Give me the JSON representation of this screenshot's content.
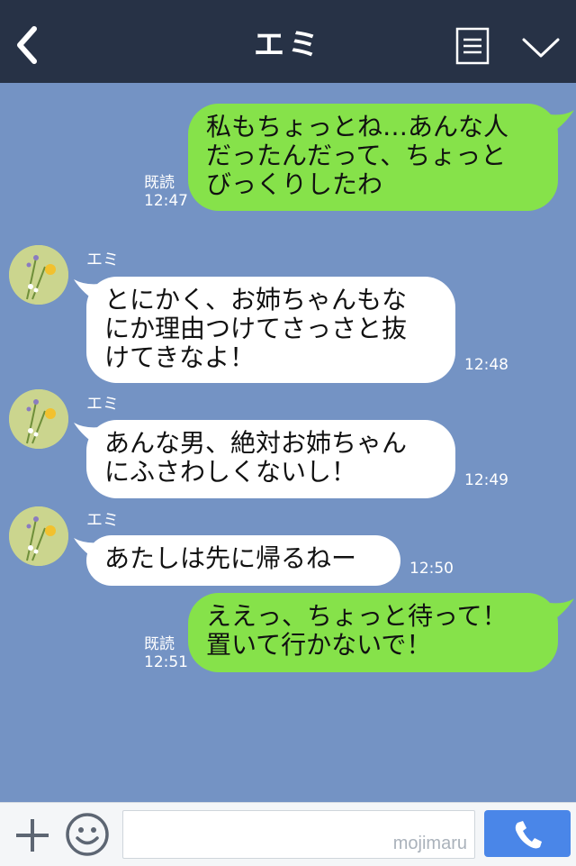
{
  "header": {
    "title": "エミ",
    "back_icon": "chevron-left-icon",
    "menu_icon": "list-icon",
    "dropdown_icon": "chevron-down-icon"
  },
  "messages": [
    {
      "direction": "out",
      "lines": [
        "私もちょっとね…あんな人",
        "だったんだって、ちょっと",
        "びっくりしたわ"
      ],
      "read": "既読",
      "time": "12:47"
    },
    {
      "direction": "in",
      "sender": "エミ",
      "lines": [
        "とにかく、お姉ちゃんもな",
        "にか理由つけてさっさと抜",
        "けてきなよ！"
      ],
      "time": "12:48"
    },
    {
      "direction": "in",
      "sender": "エミ",
      "lines": [
        "あんな男、絶対お姉ちゃん",
        "にふさわしくないし！"
      ],
      "time": "12:49"
    },
    {
      "direction": "in",
      "sender": "エミ",
      "lines": [
        "あたしは先に帰るねー"
      ],
      "time": "12:50"
    },
    {
      "direction": "out",
      "lines": [
        "ええっ、ちょっと待って！",
        "置いて行かないで！"
      ],
      "read": "既読",
      "time": "12:51"
    }
  ],
  "footer": {
    "plus_icon": "plus-icon",
    "emoji_icon": "smiley-icon",
    "input_value": "",
    "watermark": "mojimaru",
    "call_icon": "phone-icon"
  },
  "colors": {
    "background": "#7493c4",
    "header": "#273246",
    "outgoing_bubble": "#86e24a",
    "incoming_bubble": "#ffffff",
    "call_button": "#4a86e8"
  }
}
